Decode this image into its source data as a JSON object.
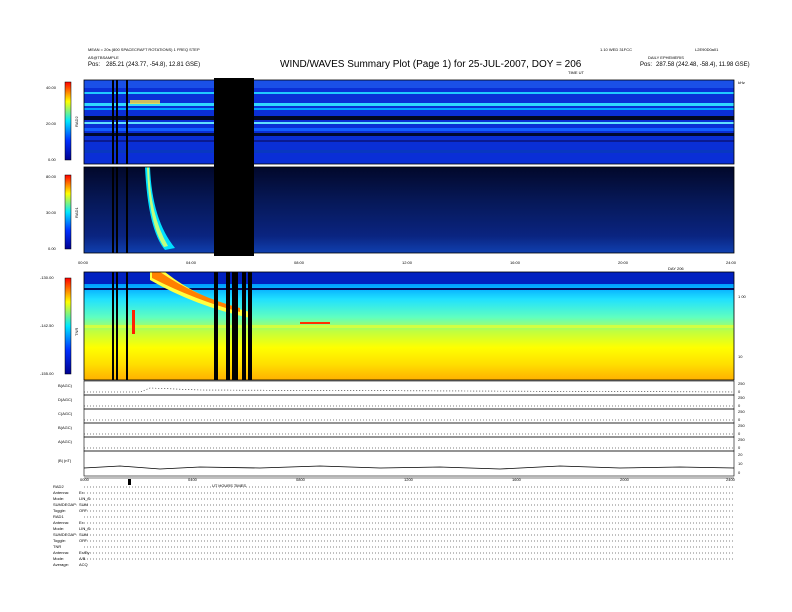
{
  "header": {
    "title": "WIND/WAVES Summary Plot (Page 1) for 25-JUL-2007, DOY = 206",
    "left_line1": "MEAN = 20s (800 SPACECRAFT ROTATIONS) 1 FREQ STEP",
    "left_line2": "AS@TBSAMPLE",
    "left_pos_label": "Pos:",
    "left_pos_value": "285.21 (243.77, -54.8), 12.81 GSE)",
    "right_line1": "1.10 WED 31FCC",
    "right_line2": "DAILY  EPHEMERIS",
    "right_pos_label": "Pos:",
    "right_pos_value": "287.58 (242.48, -58.4), 11.98 GSE)",
    "right_top_id": "L2E90D0a01",
    "time_label": "TIME UT"
  },
  "colors": {
    "background": "#0a1a8a",
    "band_dark": "#000000",
    "frame": "#000000",
    "colorbar": [
      "#000080",
      "#0000ff",
      "#00ffff",
      "#ffff00",
      "#ff0000"
    ]
  },
  "panels": {
    "rad2": {
      "label": "RAD2",
      "ticks": [
        "40.00",
        "20.00",
        "0.00"
      ]
    },
    "rad1": {
      "label": "RAD1",
      "ticks": [
        "80.00",
        "30.00",
        "0.00"
      ]
    },
    "tnr": {
      "label": "TNR",
      "ticks": [
        "-130.00",
        "-142.50",
        "-155.00"
      ],
      "right_ticks": [
        "1 00",
        "10"
      ],
      "right_label": "kHz"
    },
    "time_ticks": [
      "00:00",
      "04:00",
      "08:00",
      "12:00",
      "16:00",
      "20:00",
      "24:00"
    ],
    "mid_ticks": [
      "00:00",
      "04:00",
      "08:00",
      "12:00",
      "16:00",
      "20:00",
      "24:00"
    ],
    "bottom_ticks": [
      "0000",
      "0400",
      "0800",
      "1200",
      "1600",
      "2000",
      "2400"
    ],
    "mid_label": "DAY 206",
    "bottom_label": "UT HOURS TIMES"
  },
  "line_panels": [
    {
      "label": "B(AGC)",
      "right": [
        "250",
        "0"
      ]
    },
    {
      "label": "D(AGC)",
      "right": [
        "250",
        "0"
      ]
    },
    {
      "label": "C(AGC)",
      "right": [
        "250",
        "0"
      ]
    },
    {
      "label": "B(AGC)",
      "right": [
        "250",
        "0"
      ]
    },
    {
      "label": "A(AGC)",
      "right": [
        "250",
        "0"
      ]
    },
    {
      "label": "|B| (nT)",
      "right": [
        "20",
        "10",
        "0"
      ]
    }
  ],
  "info_block": [
    {
      "label": "RAD2",
      "value": ""
    },
    {
      "label": "Antenna:",
      "value": "Ex"
    },
    {
      "label": "Mode:",
      "value": "LIN_S"
    },
    {
      "label": "SUMDEGAP:",
      "value": "SUM"
    },
    {
      "label": "Toggle:",
      "value": "OFF"
    },
    {
      "label": "RAD1",
      "value": ""
    },
    {
      "label": "Antenna:",
      "value": "Ex"
    },
    {
      "label": "Mode:",
      "value": "LIN_S"
    },
    {
      "label": "SUMDEGAP:",
      "value": "SUM"
    },
    {
      "label": "Toggle:",
      "value": "OFF"
    },
    {
      "label": "TNR",
      "value": ""
    },
    {
      "label": "Antenna:",
      "value": "Ex/Ey"
    },
    {
      "label": "Mode:",
      "value": "A/B"
    },
    {
      "label": "Average:",
      "value": "ACQ"
    }
  ],
  "chart_data": {
    "type": "heatmap",
    "title": "WIND/WAVES Summary Plot (Page 1) for 25-JUL-2007, DOY = 206",
    "xlabel": "TIME UT",
    "x_range_hours": [
      0,
      24
    ],
    "panels": [
      {
        "name": "RAD2",
        "ylim": [
          0,
          40
        ]
      },
      {
        "name": "RAD1",
        "ylim": [
          0,
          80
        ]
      },
      {
        "name": "TNR",
        "ylim": [
          -155,
          -130
        ]
      }
    ],
    "data_gaps_hours": [
      [
        4.9,
        6.0
      ]
    ],
    "type_iii_burst_start_hours": 2.6
  }
}
